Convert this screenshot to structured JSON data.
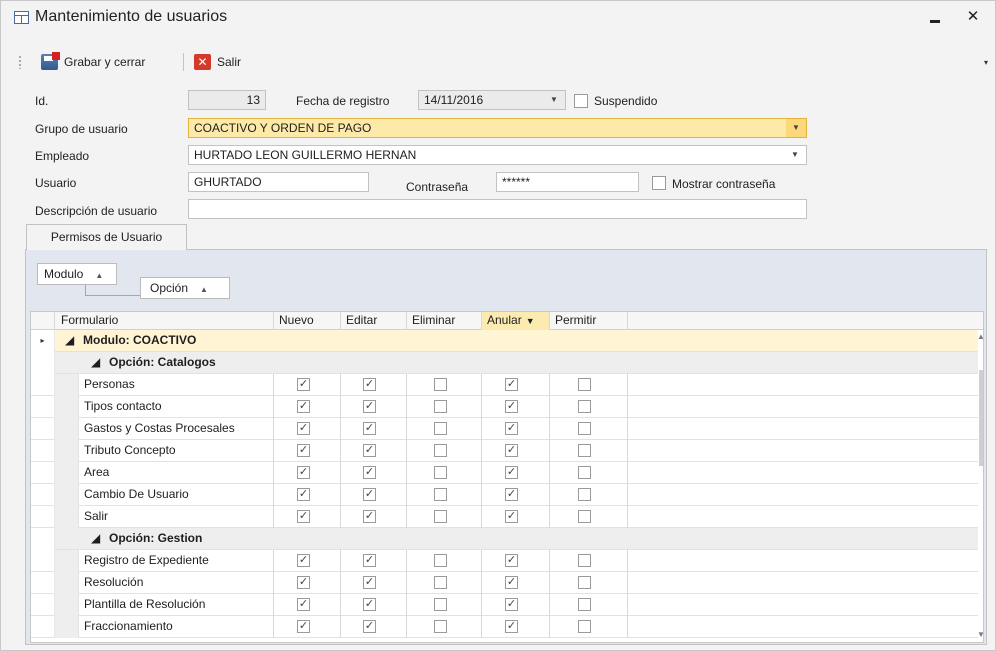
{
  "window": {
    "title": "Mantenimiento de usuarios",
    "minimize": "‒",
    "close": "✕"
  },
  "toolbar": {
    "save_label": "Grabar y cerrar",
    "exit_label": "Salir",
    "more": "▾"
  },
  "form": {
    "id_label": "Id.",
    "id_value": "13",
    "fecha_label": "Fecha de registro",
    "fecha_value": "14/11/2016",
    "suspendido_label": "Suspendido",
    "grupo_label": "Grupo de usuario",
    "grupo_value": "COACTIVO Y ORDEN DE PAGO",
    "empleado_label": "Empleado",
    "empleado_value": "HURTADO LEON GUILLERMO HERNAN",
    "usuario_label": "Usuario",
    "usuario_value": "GHURTADO",
    "contrasena_label": "Contraseña",
    "contrasena_value": "******",
    "mostrar_label": "Mostrar contraseña",
    "descripcion_label": "Descripción de usuario",
    "descripcion_value": ""
  },
  "tab": {
    "label": "Permisos de Usuario"
  },
  "grouping": {
    "modulo": "Modulo",
    "opcion": "Opción",
    "sort_icon": "▲"
  },
  "columns": [
    "Formulario",
    "Nuevo",
    "Editar",
    "Eliminar",
    "Anular",
    "Permitir"
  ],
  "groups": {
    "modulo": "Modulo: COACTIVO",
    "catalogos": "Opción: Catalogos",
    "gestion": "Opción: Gestion"
  },
  "rows": [
    {
      "name": "Personas",
      "nuevo": true,
      "editar": true,
      "eliminar": false,
      "anular": true,
      "permitir": false
    },
    {
      "name": "Tipos contacto",
      "nuevo": true,
      "editar": true,
      "eliminar": false,
      "anular": true,
      "permitir": false
    },
    {
      "name": "Gastos y Costas Procesales",
      "nuevo": true,
      "editar": true,
      "eliminar": false,
      "anular": true,
      "permitir": false
    },
    {
      "name": "Tributo Concepto",
      "nuevo": true,
      "editar": true,
      "eliminar": false,
      "anular": true,
      "permitir": false
    },
    {
      "name": "Area",
      "nuevo": true,
      "editar": true,
      "eliminar": false,
      "anular": true,
      "permitir": false
    },
    {
      "name": "Cambio De Usuario",
      "nuevo": true,
      "editar": true,
      "eliminar": false,
      "anular": true,
      "permitir": false
    },
    {
      "name": "Salir",
      "nuevo": true,
      "editar": true,
      "eliminar": false,
      "anular": true,
      "permitir": false
    },
    {
      "name": "Registro de Expediente",
      "nuevo": true,
      "editar": true,
      "eliminar": false,
      "anular": true,
      "permitir": false
    },
    {
      "name": "Resolución",
      "nuevo": true,
      "editar": true,
      "eliminar": false,
      "anular": true,
      "permitir": false
    },
    {
      "name": "Plantilla de Resolución",
      "nuevo": true,
      "editar": true,
      "eliminar": false,
      "anular": true,
      "permitir": false
    },
    {
      "name": "Fraccionamiento",
      "nuevo": true,
      "editar": true,
      "eliminar": false,
      "anular": true,
      "permitir": false
    }
  ],
  "icons": {
    "window": "form-window-icon",
    "save": "save-close-icon",
    "exit": "exit-icon",
    "expand": "◢",
    "row_pointer": "▸",
    "check": "✓",
    "filter": "filter-icon"
  },
  "colors": {
    "focused_field": "#fde9a8",
    "group_row": "#fff5d5",
    "filtered_header": "#fcebb0"
  }
}
